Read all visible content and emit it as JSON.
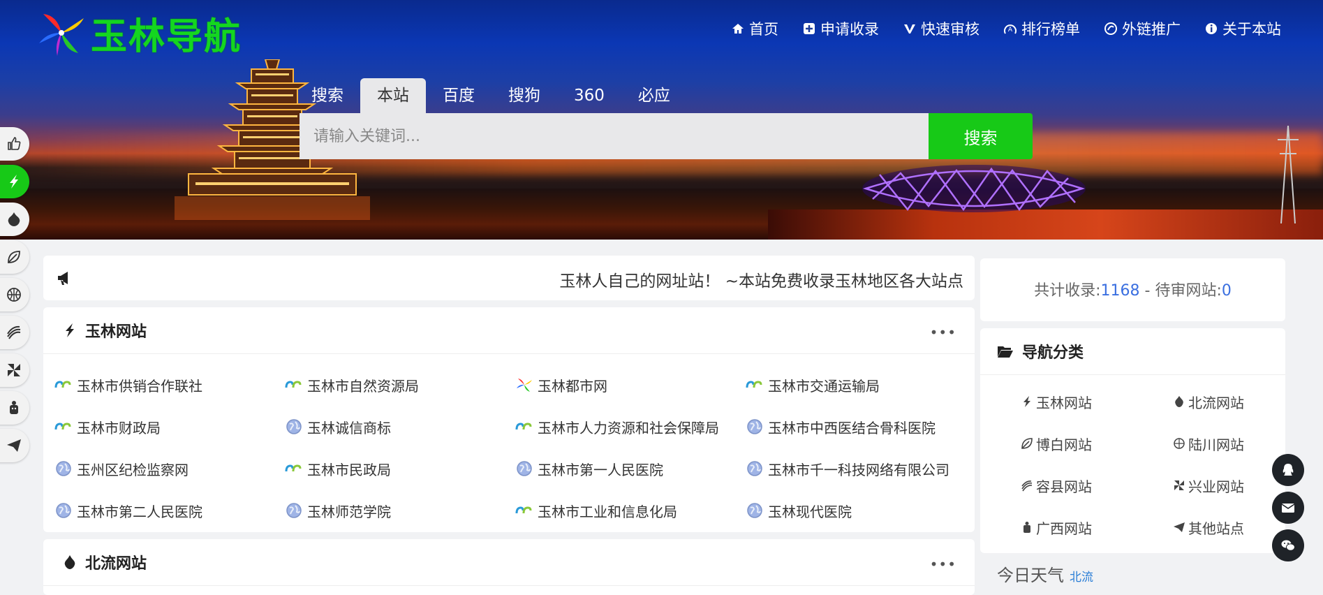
{
  "brand": {
    "logo_text": "玉林导航"
  },
  "topnav": [
    {
      "label": "首页",
      "icon": "home-icon"
    },
    {
      "label": "申请收录",
      "icon": "plus-square-icon"
    },
    {
      "label": "快速审核",
      "icon": "v-icon"
    },
    {
      "label": "排行榜单",
      "icon": "rank-icon"
    },
    {
      "label": "外链推广",
      "icon": "link-icon"
    },
    {
      "label": "关于本站",
      "icon": "info-icon"
    }
  ],
  "search": {
    "tabs": [
      "搜索",
      "本站",
      "百度",
      "搜狗",
      "360",
      "必应"
    ],
    "active_tab": "本站",
    "placeholder": "请输入关键词...",
    "button_label": "搜索"
  },
  "notice": {
    "text": "玉林人自己的网址站！ ~本站免费收录玉林地区各大站点"
  },
  "sections": [
    {
      "title": "玉林网站",
      "more": "•••",
      "sites": [
        {
          "name": "玉林市供销合作联社",
          "icon": "gov-icon"
        },
        {
          "name": "玉林市自然资源局",
          "icon": "gov-icon"
        },
        {
          "name": "玉林都市网",
          "icon": "pinwheel-icon"
        },
        {
          "name": "玉林市交通运输局",
          "icon": "gov-icon"
        },
        {
          "name": "玉林市财政局",
          "icon": "gov-icon"
        },
        {
          "name": "玉林诚信商标",
          "icon": "globe-icon"
        },
        {
          "name": "玉林市人力资源和社会保障局",
          "icon": "gov-icon"
        },
        {
          "name": "玉林市中西医结合骨科医院",
          "icon": "globe-icon"
        },
        {
          "name": "玉州区纪检监察网",
          "icon": "globe-icon"
        },
        {
          "name": "玉林市民政局",
          "icon": "gov-icon"
        },
        {
          "name": "玉林市第一人民医院",
          "icon": "globe-icon"
        },
        {
          "name": "玉林市千一科技网络有限公司",
          "icon": "globe-icon"
        },
        {
          "name": "玉林市第二人民医院",
          "icon": "globe-icon"
        },
        {
          "name": "玉林师范学院",
          "icon": "globe-icon"
        },
        {
          "name": "玉林市工业和信息化局",
          "icon": "gov-icon"
        },
        {
          "name": "玉林现代医院",
          "icon": "globe-icon"
        }
      ]
    },
    {
      "title": "北流网站",
      "more": "•••"
    }
  ],
  "stats": {
    "label1": "共计收录:",
    "count": "1168",
    "sep": " - ",
    "label2": "待审网站:",
    "pending": "0"
  },
  "categories": {
    "title": "导航分类",
    "items": [
      "玉林网站",
      "北流网站",
      "博白网站",
      "陆川网站",
      "容县网站",
      "兴业网站",
      "广西网站",
      "其他站点"
    ]
  },
  "weather": {
    "label": "今日天气",
    "city": "北流"
  },
  "colors": {
    "accent_green": "#17c917",
    "link_blue": "#3a6fe0"
  }
}
